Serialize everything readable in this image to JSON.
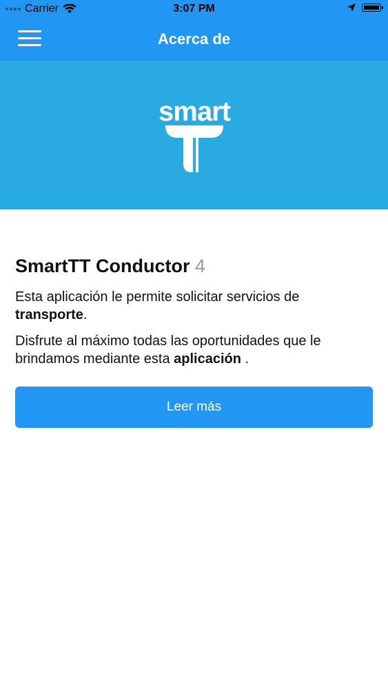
{
  "status_bar": {
    "carrier": "Carrier",
    "time": "3:07 PM"
  },
  "navbar": {
    "title": "Acerca de",
    "menu_icon": "hamburger-menu-icon"
  },
  "hero": {
    "logo_text": "smart",
    "logo_icon": "tt-logo-icon"
  },
  "about": {
    "app_name": "SmartTT Conductor",
    "version": "4",
    "para1_text": "Esta aplicación le permite solicitar servicios de ",
    "para1_bold": "transporte",
    "para1_end": ".",
    "para2_text": "Disfrute al máximo todas las oportunidades que le brindamos mediante esta ",
    "para2_bold": "aplicación",
    "para2_end": " .",
    "button_label": "Leer más"
  },
  "colors": {
    "nav_blue": "#2196f3",
    "hero_blue": "#29abe2",
    "button_blue": "#2196f3"
  }
}
